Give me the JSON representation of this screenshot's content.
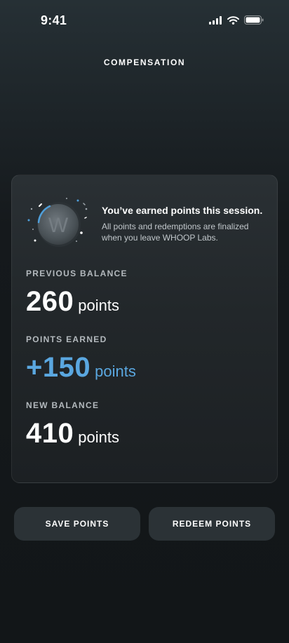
{
  "status_bar": {
    "time": "9:41"
  },
  "header": {
    "title": "COMPENSATION"
  },
  "card": {
    "intro": {
      "title": "You’ve earned points this session.",
      "text": "All points and redemptions are finalized when you leave WHOOP Labs."
    },
    "stats": [
      {
        "label": "PREVIOUS BALANCE",
        "value": "260",
        "unit": "points"
      },
      {
        "label": "POINTS EARNED",
        "value": "+150",
        "unit": "points"
      },
      {
        "label": "NEW BALANCE",
        "value": "410",
        "unit": "points"
      }
    ]
  },
  "buttons": {
    "save": "SAVE POINTS",
    "redeem": "REDEEM POINTS"
  },
  "colors": {
    "accent_blue": "#5aa7e0",
    "button_bg": "#2b3236",
    "card_bg": "#22272a"
  },
  "icons": [
    "signal-icon",
    "wifi-icon",
    "battery-icon",
    "whoop-medal-icon"
  ]
}
